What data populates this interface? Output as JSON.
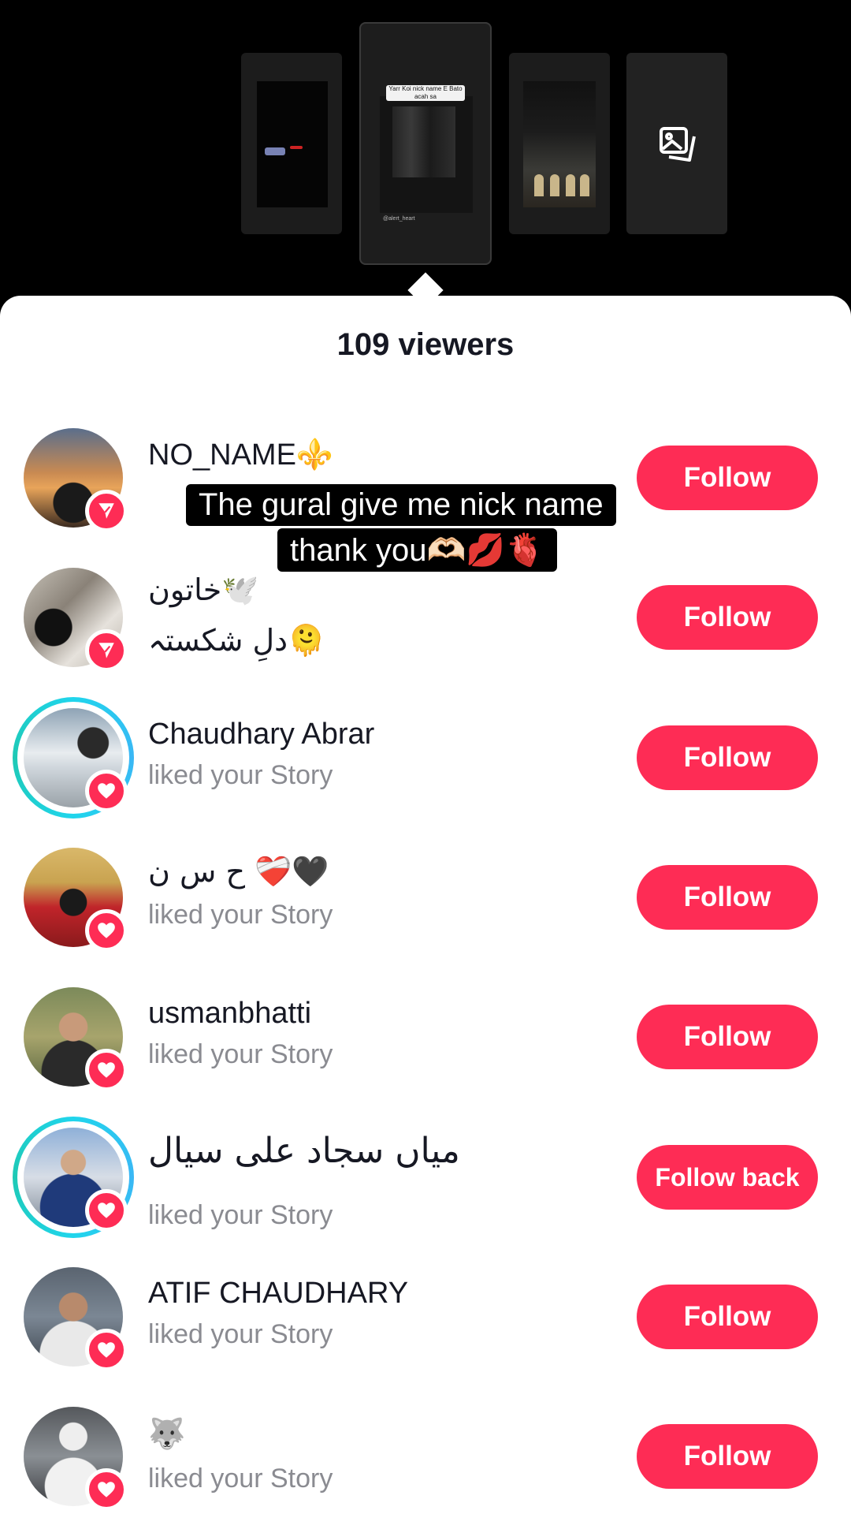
{
  "header": {
    "viewers_count_label": "109 viewers"
  },
  "story_thumbnails": {
    "caption_text": "Yarr Koi nick name E Bato acah sa",
    "tag_text": "@alert_heart"
  },
  "caption_overlay": {
    "line1": "The gural give me nick name",
    "line2": "thank you🫶🏻💋🫀"
  },
  "viewers": [
    {
      "name": "NO_NAME⚜️",
      "subtitle": "",
      "badge": "send-icon",
      "ring": false,
      "button": "Follow"
    },
    {
      "name": "خاتون🕊️",
      "subtitle": "دلِ شکستہ🫠",
      "badge": "send-icon",
      "ring": false,
      "button": "Follow"
    },
    {
      "name": "Chaudhary Abrar",
      "subtitle": "liked your Story",
      "badge": "heart-icon",
      "ring": true,
      "button": "Follow"
    },
    {
      "name": "ح س ن ❤️‍🩹🖤",
      "subtitle": "liked your Story",
      "badge": "heart-icon",
      "ring": false,
      "button": "Follow"
    },
    {
      "name": "usmanbhatti",
      "subtitle": "liked your Story",
      "badge": "heart-icon",
      "ring": false,
      "button": "Follow"
    },
    {
      "name": "میاں سجاد علی سیال",
      "subtitle": "liked your Story",
      "badge": "heart-icon",
      "ring": true,
      "button": "Follow back"
    },
    {
      "name": "ATIF CHAUDHARY",
      "subtitle": "liked your Story",
      "badge": "heart-icon",
      "ring": false,
      "button": "Follow"
    },
    {
      "name": "🐺",
      "subtitle": "liked your Story",
      "badge": "heart-icon",
      "ring": false,
      "button": "Follow"
    }
  ],
  "colors": {
    "accent": "#fe2c55",
    "ring": "#20d5ec",
    "text_primary": "#161823",
    "text_secondary": "#8a8b91"
  }
}
